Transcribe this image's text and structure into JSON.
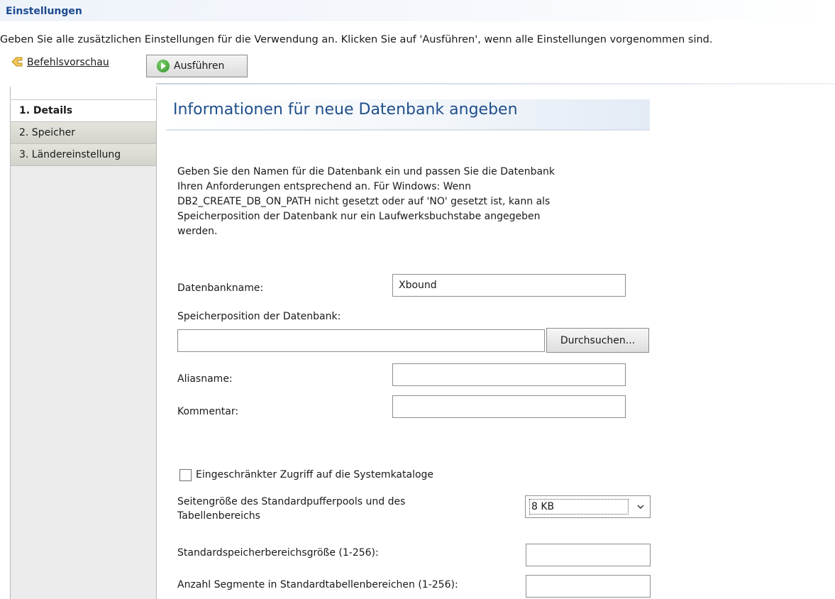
{
  "header": {
    "title": "Einstellungen",
    "description": "Geben Sie alle zusätzlichen Einstellungen für die Verwendung an. Klicken Sie auf 'Ausführen', wenn alle Einstellungen vorgenommen sind."
  },
  "toolbar": {
    "preview_label": "Befehlsvorschau",
    "run_label": "Ausführen"
  },
  "sidebar": {
    "items": [
      {
        "label": "1. Details"
      },
      {
        "label": "2. Speicher"
      },
      {
        "label": "3. Ländereinstellung"
      }
    ]
  },
  "panel": {
    "title": "Informationen für neue Datenbank angeben",
    "intro_lines": [
      "Geben Sie den Namen für die Datenbank ein und passen Sie die Datenbank",
      "Ihren Anforderungen entsprechend an. Für Windows: Wenn",
      "DB2_CREATE_DB_ON_PATH nicht gesetzt oder auf 'NO' gesetzt ist, kann als",
      "Speicherposition der Datenbank nur ein Laufwerksbuchstabe angegeben",
      "werden."
    ]
  },
  "form": {
    "db_name_label": "Datenbankname:",
    "db_name_value": "Xbound",
    "location_label": "Speicherposition der Datenbank:",
    "location_value": "",
    "browse_label": "Durchsuchen...",
    "alias_label": "Aliasname:",
    "alias_value": "",
    "comment_label": "Kommentar:",
    "comment_value": "",
    "restricted_label": "Eingeschränkter Zugriff auf die Systemkataloge",
    "restricted_checked": false,
    "pagesize_label_line1": "Seitengröße des Standardpufferpools und des",
    "pagesize_label_line2": "Tabellenbereichs",
    "pagesize_value": "8 KB",
    "extent_label": "Standardspeicherbereichsgröße (1-256):",
    "extent_value": "",
    "segments_label": "Anzahl Segmente in Standardtabellenbereichen (1-256):",
    "segments_value": ""
  }
}
